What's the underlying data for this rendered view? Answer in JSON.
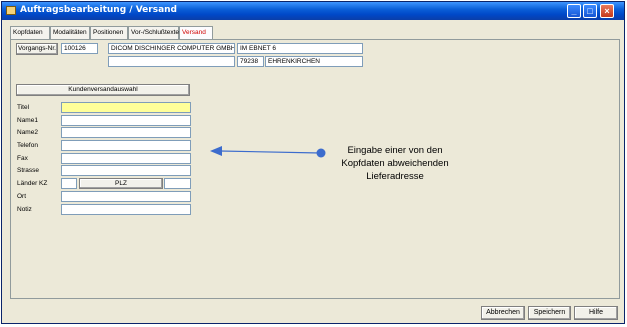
{
  "window": {
    "title": "Auftragsbearbeitung / Versand"
  },
  "tabs": [
    {
      "label": "Kopfdaten"
    },
    {
      "label": "Modalitäten"
    },
    {
      "label": "Positionen"
    },
    {
      "label": "Vor-/Schlußtexte"
    },
    {
      "label": "Versand",
      "active": true
    }
  ],
  "header": {
    "vorgang_button": "Vorgangs-Nr.",
    "vorgang_value": "100126",
    "customer_name": "DICOM DISCHINGER COMPUTER GMBH",
    "customer_name2": "",
    "street": "IM EBNET 6",
    "zip": "79238",
    "city": "EHRENKIRCHEN"
  },
  "form": {
    "select_button": "Kundenversandauswahl",
    "fields": {
      "titel": {
        "label": "Titel",
        "value": ""
      },
      "name1": {
        "label": "Name1",
        "value": ""
      },
      "name2": {
        "label": "Name2",
        "value": ""
      },
      "telefon": {
        "label": "Telefon",
        "value": ""
      },
      "fax": {
        "label": "Fax",
        "value": ""
      },
      "strasse": {
        "label": "Strasse",
        "value": ""
      },
      "laender_kz": {
        "label": "Länder KZ",
        "value": ""
      },
      "plz": {
        "label": "PLZ",
        "value": ""
      },
      "ort": {
        "label": "Ort",
        "value": ""
      },
      "notiz": {
        "label": "Notiz",
        "value": ""
      }
    }
  },
  "annotation": {
    "line1": "Eingabe einer von den",
    "line2": "Kopfdaten abweichenden",
    "line3": "Lieferadresse",
    "color": "#3c6ccd"
  },
  "footer": {
    "cancel": "Abbrechen",
    "save": "Speichern",
    "help": "Hilfe"
  },
  "colors": {
    "active_tab": "#d00000",
    "highlight_field": "#ffff99",
    "titlebar": "#0048c8"
  }
}
